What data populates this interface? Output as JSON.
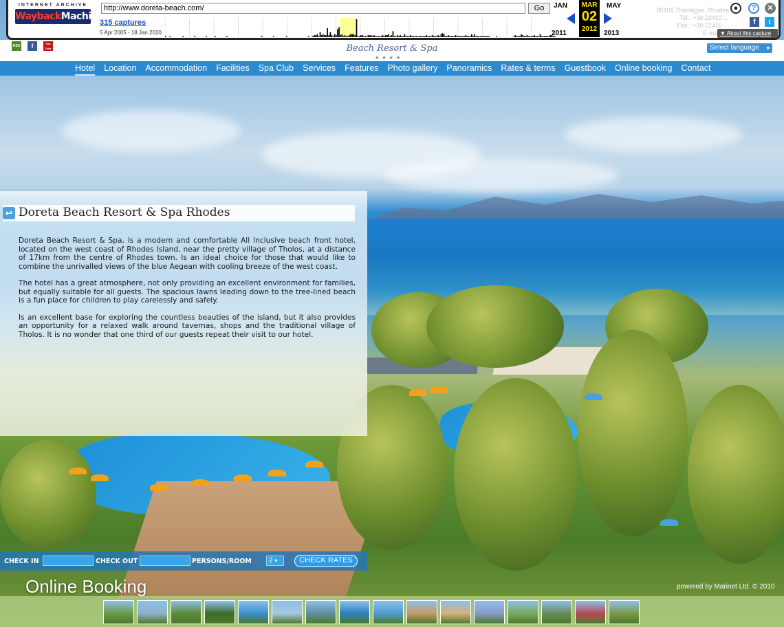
{
  "wayback": {
    "url": "http://www.doreta-beach.com/",
    "go_label": "Go",
    "logo_top": "INTERNET ARCHIVE",
    "logo_main_a": "Wayback",
    "logo_main_b": "Machine",
    "captures": "315 captures",
    "range": "5 Apr 2005 - 18 Jan 2020",
    "prev_month": "JAN",
    "cur_month": "MAR",
    "next_month": "MAY",
    "cur_day": "02",
    "prev_year": "2011",
    "cur_year": "2012",
    "next_year": "2013",
    "about": "About this capture",
    "sparkline": [
      1,
      0,
      0,
      1,
      0,
      0,
      0,
      0,
      0,
      0,
      0,
      0,
      1,
      0,
      0,
      0,
      0,
      0,
      0,
      0,
      1,
      0,
      0,
      0,
      0,
      0,
      0,
      0,
      1,
      0,
      0,
      0,
      0,
      0,
      1,
      0,
      0,
      0,
      0,
      0,
      0,
      0,
      1,
      0,
      0,
      0,
      0,
      0,
      0,
      0,
      0,
      0,
      0,
      0,
      0,
      0,
      0,
      0,
      0,
      0,
      0,
      0,
      0,
      0,
      0,
      0,
      1,
      0,
      0,
      0,
      0,
      0,
      0,
      0,
      1,
      0,
      0,
      0,
      0,
      0,
      0,
      0,
      0,
      1,
      0,
      0,
      0,
      0,
      0,
      0,
      0,
      0,
      0,
      0,
      0,
      0,
      0,
      0,
      1,
      0,
      0,
      1,
      2,
      2,
      3,
      1,
      5,
      2,
      3,
      2,
      2,
      9,
      2,
      5,
      2,
      1,
      3,
      2,
      8,
      10,
      2,
      3,
      1,
      2,
      1,
      1,
      2,
      3,
      3,
      3,
      2,
      18,
      1,
      1,
      2,
      2,
      1,
      1,
      1,
      2,
      2,
      2,
      1,
      2,
      1,
      1,
      1,
      1,
      1,
      2,
      1,
      2,
      2,
      3,
      1,
      2,
      6,
      1,
      1,
      2,
      1,
      2,
      1,
      1,
      3,
      1,
      1,
      1,
      2,
      1,
      1,
      1,
      1,
      1,
      1,
      1,
      1,
      1,
      1,
      2,
      1,
      1,
      1,
      2,
      1,
      1,
      1,
      2,
      1,
      3,
      4,
      3,
      1,
      1,
      2,
      1,
      1,
      1,
      1,
      2,
      1,
      1,
      1,
      1,
      1,
      1,
      2,
      1,
      1,
      1,
      3,
      1,
      3,
      1,
      1,
      1,
      1,
      1,
      1,
      1,
      1,
      1,
      1,
      0,
      0,
      0,
      0,
      1,
      0,
      0,
      0,
      0,
      0,
      0,
      0,
      0,
      0,
      0,
      0,
      1,
      2,
      1,
      1,
      1,
      3,
      2,
      1,
      1,
      2,
      1,
      1,
      1,
      1,
      2,
      1,
      1,
      1,
      3,
      1,
      1,
      1,
      1,
      1,
      1,
      2,
      2,
      1,
      1
    ],
    "highlight_color": "#ffff9a"
  },
  "header": {
    "social": [
      "RSS",
      "f",
      "You Tube"
    ],
    "logo_text": "Beach Resort & Spa",
    "logo_stars": "★★★★",
    "language": "Select language",
    "contact": [
      "85106 Theologos, Rhodes",
      "Tel.: +30 22410 ...",
      "Fax.: +30 22410 ...",
      "E-mail: ..."
    ]
  },
  "nav": {
    "items": [
      "Hotel",
      "Location",
      "Accommodation",
      "Facilities",
      "Spa Club",
      "Services",
      "Features",
      "Photo gallery",
      "Panoramics",
      "Rates & terms",
      "Guestbook",
      "Online booking",
      "Contact"
    ],
    "active": 0
  },
  "content": {
    "title": "Doreta Beach Resort & Spa Rhodes",
    "paragraphs": [
      "Doreta Beach Resort & Spa, is a modern and comfortable All Inclusive beach front hotel, located on the west coast of Rhodes Island, near the pretty village of Tholos, at a distance of 17km from the centre of Rhodes town. Is an ideal choice for those that would like to combine the unrivalled views of the blue Aegean with cooling breeze of the west coast.",
      "The hotel has a great atmosphere, not only providing an excellent environment for families, but equally suitable for all guests. The spacious lawns leading down to the tree-lined beach is a fun place for children to play carelessly and safely.",
      "Is an excellent base for exploring the countless beauties of the island, but it also provides an opportunity for a relaxed walk around tavernas, shops and the traditional village of Tholos. It is no wonder that one third of our guests repeat their visit to our hotel."
    ]
  },
  "booking": {
    "check_in": "CHECK IN",
    "check_out": "CHECK OUT",
    "persons": "PERSONS/ROOM",
    "persons_value": "2",
    "button": "CHECK RATES",
    "title": "Online Booking",
    "powered": "powered by Marinet Ltd. © 2010"
  },
  "thumbnails": {
    "colors": [
      "#6e9a4a",
      "#8fb0c8",
      "#5e8a3c",
      "#3f6a2c",
      "#3a8ed0",
      "#a7c7e0",
      "#5d8fa0",
      "#2a7fc0",
      "#4f9ad0",
      "#c79a6a",
      "#d8b07a",
      "#8a9ac8",
      "#7aa860",
      "#6a8a5a",
      "#b84a5a",
      "#7a9a4a"
    ]
  }
}
